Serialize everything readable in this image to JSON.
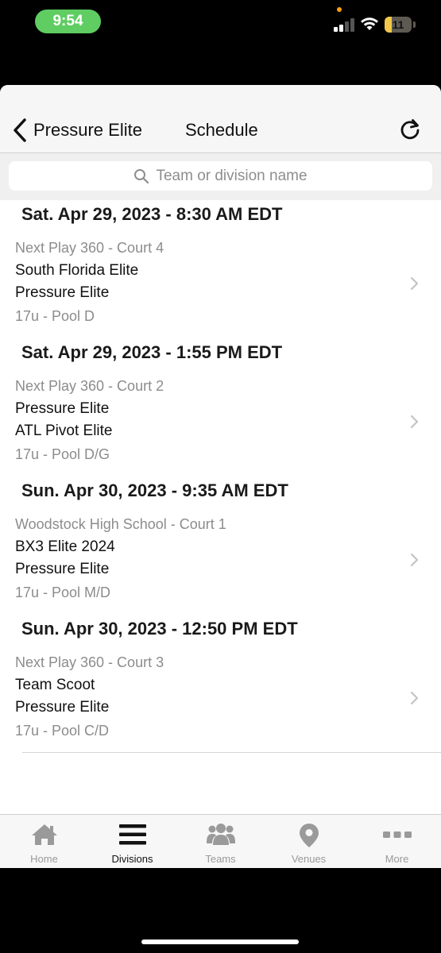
{
  "status_bar": {
    "time": "9:54",
    "battery": "11"
  },
  "nav": {
    "back_label": "Pressure Elite",
    "title": "Schedule"
  },
  "search": {
    "placeholder": "Team or division name"
  },
  "games": [
    {
      "datetime": "Sat. Apr 29, 2023 - 8:30 AM EDT",
      "venue": "Next Play 360 - Court 4",
      "team1": "South Florida Elite",
      "team2": "Pressure Elite",
      "pool": "17u - Pool D"
    },
    {
      "datetime": "Sat. Apr 29, 2023 - 1:55 PM EDT",
      "venue": "Next Play 360 - Court 2",
      "team1": "Pressure Elite",
      "team2": "ATL Pivot Elite",
      "pool": "17u - Pool D/G"
    },
    {
      "datetime": "Sun. Apr 30, 2023 - 9:35 AM EDT",
      "venue": "Woodstock High School - Court 1",
      "team1": "BX3 Elite 2024",
      "team2": "Pressure Elite",
      "pool": "17u - Pool M/D"
    },
    {
      "datetime": "Sun. Apr 30, 2023 - 12:50 PM EDT",
      "venue": "Next Play 360 - Court 3",
      "team1": "Team Scoot",
      "team2": "Pressure Elite",
      "pool": "17u - Pool C/D"
    }
  ],
  "tabs": [
    {
      "label": "Home",
      "icon": "home-icon",
      "active": false
    },
    {
      "label": "Divisions",
      "icon": "menu-icon",
      "active": true
    },
    {
      "label": "Teams",
      "icon": "people-icon",
      "active": false
    },
    {
      "label": "Venues",
      "icon": "map-pin-icon",
      "active": false
    },
    {
      "label": "More",
      "icon": "ellipsis-icon",
      "active": false
    }
  ],
  "colors": {
    "time_pill": "#5fcd62",
    "active_tab": "#111111",
    "inactive_tab": "#9a9a9a",
    "battery_fill": "#f3c84a"
  }
}
